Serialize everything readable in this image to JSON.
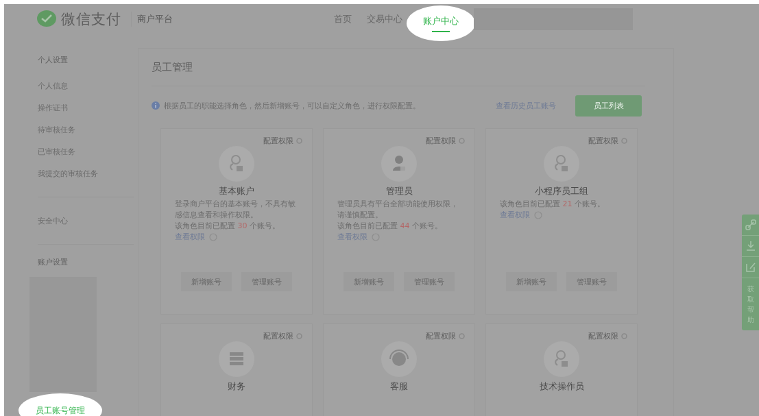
{
  "header": {
    "logo_text": "微信支付",
    "platform": "商户平台",
    "nav": [
      {
        "label": "首页",
        "selected": false
      },
      {
        "label": "交易中心",
        "selected": false
      },
      {
        "label": "账户中心",
        "selected": true
      }
    ],
    "redacted_box": true
  },
  "sidebar": {
    "groups": [
      {
        "title": "个人设置",
        "items": [
          {
            "kind": "link",
            "label": "个人信息",
            "selected": false
          },
          {
            "kind": "link",
            "label": "操作证书",
            "selected": false
          },
          {
            "kind": "link",
            "label": "待审核任务",
            "selected": false
          },
          {
            "kind": "link",
            "label": "已审核任务",
            "selected": false
          },
          {
            "kind": "link",
            "label": "我提交的审核任务",
            "selected": false
          }
        ]
      },
      {
        "items": [
          {
            "kind": "link",
            "label": "安全中心",
            "selected": false
          }
        ]
      },
      {
        "title": "账户设置",
        "items": [
          {
            "kind": "redacted"
          },
          {
            "kind": "link",
            "label": "员工账号管理",
            "selected": true
          }
        ]
      }
    ]
  },
  "main": {
    "title": "员工管理",
    "notice": "根据员工的职能选择角色，然后新增账号，可以自定义角色，进行权限配置。",
    "history_link": "查看历史员工账号",
    "list_button": "员工列表",
    "roles": [
      {
        "kind": "person-outline",
        "config": "配置权限",
        "name": "基本账户",
        "lines": [
          "登录商户平台的基本账号，不具有敏",
          "感信息查看和操作权限。"
        ],
        "count_prefix": "该角色目前已配置",
        "count": "30",
        "count_suffix": "个账号。",
        "view": "查看权限",
        "buttons": [
          "新增账号",
          "管理账号"
        ]
      },
      {
        "kind": "person-solid",
        "config": "配置权限",
        "name": "管理员",
        "lines": [
          "管理员具有平台全部功能使用权限，",
          "请谨慎配置。"
        ],
        "count_prefix": "该角色目前已配置",
        "count": "44",
        "count_suffix": "个账号。",
        "view": "查看权限",
        "buttons": [
          "新增账号",
          "管理账号"
        ]
      },
      {
        "kind": "person-outline",
        "config": "配置权限",
        "name": "小程序员工组",
        "count_prefix": "该角色目前已配置",
        "count": "21",
        "count_suffix": "个账号。",
        "view": "查看权限",
        "buttons": [
          "新增账号",
          "管理账号"
        ]
      },
      {
        "kind": "ledger",
        "config": "配置权限",
        "name": "财务"
      },
      {
        "kind": "headset",
        "config": "配置权限",
        "name": "客服"
      },
      {
        "kind": "person-outline",
        "config": "配置权限",
        "name": "技术操作员"
      }
    ]
  },
  "float_bar": {
    "tools": [
      {
        "kind": "link"
      },
      {
        "kind": "download"
      },
      {
        "kind": "edit"
      }
    ],
    "help": "获取帮助"
  }
}
